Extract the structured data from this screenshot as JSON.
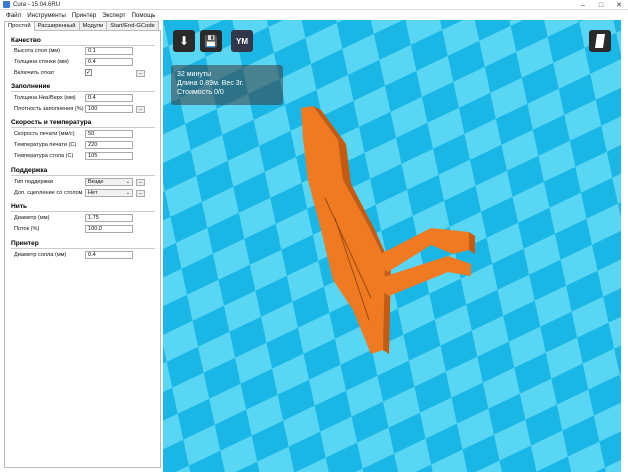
{
  "window": {
    "title": "Cura - 15.04.6RU"
  },
  "menu": [
    "Файл",
    "Инструменты",
    "Принтер",
    "Эксперт",
    "Помощь"
  ],
  "tabs": [
    {
      "label": "Простой",
      "active": true
    },
    {
      "label": "Расширенный",
      "active": false
    },
    {
      "label": "Модули",
      "active": false
    },
    {
      "label": "Start/End-GCode",
      "active": false
    }
  ],
  "sections": {
    "quality": {
      "title": "Качество",
      "layer_height": {
        "label": "Высота слоя (мм)",
        "value": "0.1"
      },
      "shell_thickness": {
        "label": "Толщина стенки (мм)",
        "value": "0.4"
      },
      "retraction": {
        "label": "Включить откат",
        "checked": true
      }
    },
    "fill": {
      "title": "Заполнение",
      "bottom_top": {
        "label": "Толщина Низ/Верх (мм)",
        "value": "0.4"
      },
      "density": {
        "label": "Плотность заполнения (%)",
        "value": "100"
      }
    },
    "speed": {
      "title": "Скорость и температура",
      "print_speed": {
        "label": "Скорость печати (мм/с)",
        "value": "50"
      },
      "print_temp": {
        "label": "Температура печати (С)",
        "value": "220"
      },
      "bed_temp": {
        "label": "Температура стола (С)",
        "value": "105"
      }
    },
    "support": {
      "title": "Поддержка",
      "support_type": {
        "label": "Тип поддержки",
        "value": "Везде"
      },
      "adhesion": {
        "label": "Доп. сцепление со столом",
        "value": "Нет"
      }
    },
    "filament": {
      "title": "Нить",
      "diameter": {
        "label": "Диаметр (мм)",
        "value": "1.75"
      },
      "flow": {
        "label": "Поток (%)",
        "value": "100.0"
      }
    },
    "printer": {
      "title": "Принтер",
      "nozzle": {
        "label": "Диаметр сопла (мм)",
        "value": "0.4"
      }
    }
  },
  "viewport": {
    "info_time": "32 минуты",
    "info_len": "Длина 0.89м. Вес 3г.",
    "info_cost": "Стоимость 0/0",
    "ym_label": "YM",
    "grid_light": "#5ad6f5",
    "grid_dark": "#1ab7e6",
    "model_color": "#f07a22"
  },
  "icons": [
    "load-model-icon",
    "save-gcode-icon",
    "youmagine-icon",
    "view-mode-icon"
  ]
}
